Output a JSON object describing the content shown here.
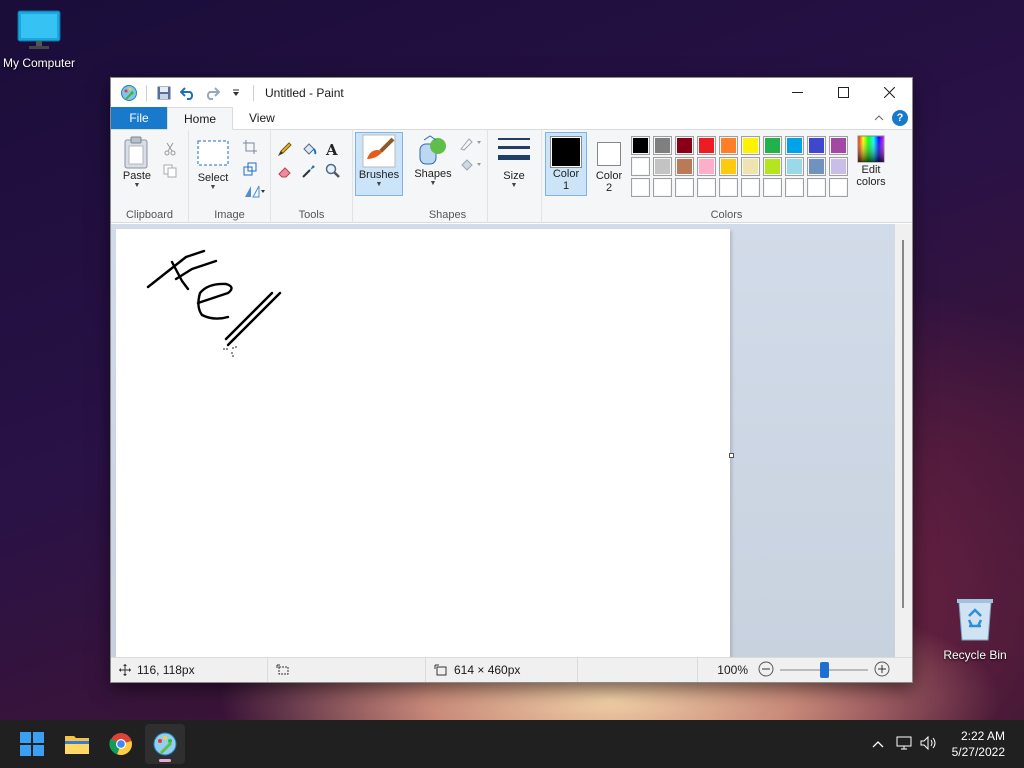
{
  "desktop": {
    "my_computer_label": "My Computer",
    "recycle_bin_label": "Recycle Bin"
  },
  "window": {
    "title": "Untitled - Paint",
    "tabs": {
      "file": "File",
      "home": "Home",
      "view": "View"
    }
  },
  "ribbon": {
    "clipboard": {
      "paste": "Paste",
      "group": "Clipboard"
    },
    "image": {
      "select": "Select",
      "group": "Image"
    },
    "tools": {
      "group": "Tools"
    },
    "brushes": {
      "label": "Brushes"
    },
    "shapes": {
      "label": "Shapes",
      "group": "Shapes"
    },
    "size": {
      "label": "Size"
    },
    "color1": {
      "line1": "Color",
      "line2": "1",
      "value": "#000000"
    },
    "color2": {
      "line1": "Color",
      "line2": "2",
      "value": "#ffffff"
    },
    "edit_colors": {
      "line1": "Edit",
      "line2": "colors"
    },
    "colors_group": "Colors",
    "palette_row1": [
      "#000000",
      "#7f7f7f",
      "#880015",
      "#ed1c24",
      "#ff7f27",
      "#fff200",
      "#22b14c",
      "#00a2e8",
      "#3f48cc",
      "#a349a4"
    ],
    "palette_row2": [
      "#ffffff",
      "#c3c3c3",
      "#b97a57",
      "#ffaec9",
      "#ffc90e",
      "#efe4b0",
      "#b5e61d",
      "#99d9ea",
      "#7092be",
      "#c8bfe7"
    ],
    "palette_row3": [
      "#ffffff",
      "#ffffff",
      "#ffffff",
      "#ffffff",
      "#ffffff",
      "#ffffff",
      "#ffffff",
      "#ffffff",
      "#ffffff",
      "#ffffff"
    ]
  },
  "status": {
    "cursor_pos": "116, 118px",
    "canvas_size": "614 × 460px",
    "zoom": "100%",
    "zoom_level": 1.0
  },
  "taskbar": {
    "time": "2:22 AM",
    "date": "5/27/2022"
  }
}
